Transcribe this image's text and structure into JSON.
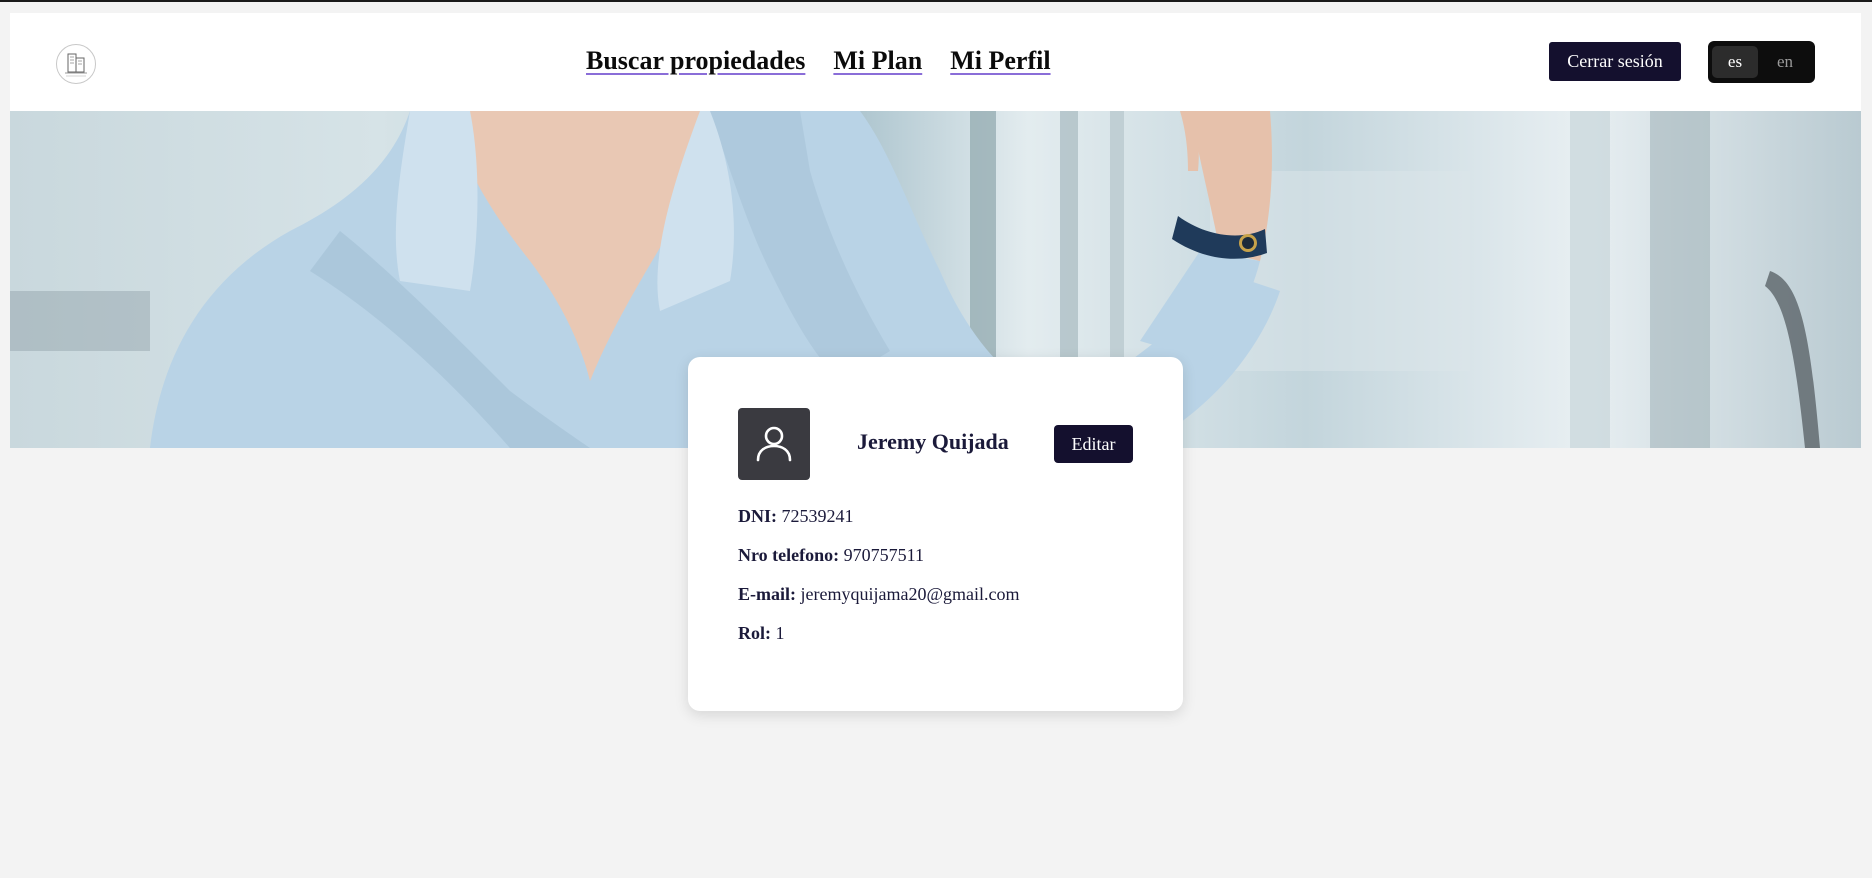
{
  "nav": {
    "items": [
      {
        "label": "Buscar propiedades"
      },
      {
        "label": "Mi Plan"
      },
      {
        "label": "Mi Perfil"
      }
    ],
    "logout_label": "Cerrar sesión",
    "languages": {
      "active": "es",
      "inactive": "en"
    }
  },
  "profile": {
    "name": "Jeremy Quijada",
    "edit_label": "Editar",
    "fields": [
      {
        "label": "DNI:",
        "value": "72539241"
      },
      {
        "label": "Nro telefono:",
        "value": "970757511"
      },
      {
        "label": "E-mail:",
        "value": "jeremyquijama20@gmail.com"
      },
      {
        "label": "Rol:",
        "value": "1"
      }
    ]
  },
  "colors": {
    "primary_button": "#14102e",
    "text_dark": "#1b1a3a",
    "page_background": "#f3f3f3",
    "avatar_background": "#3a3a40"
  },
  "icons": {
    "avatar": "user-icon",
    "logo": "building-logo"
  }
}
